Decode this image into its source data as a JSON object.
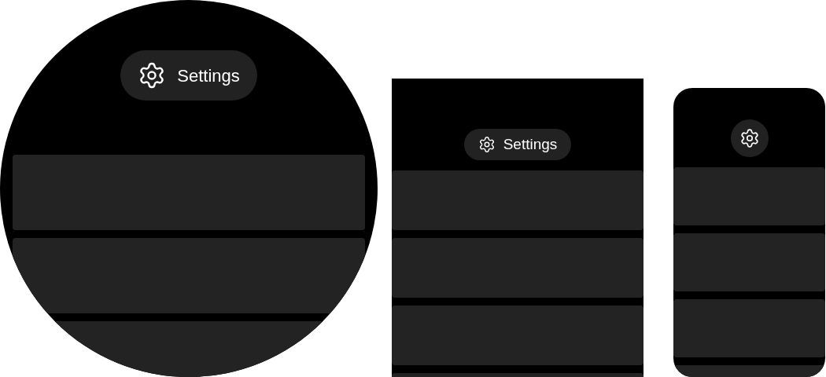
{
  "screens": [
    {
      "kind": "round",
      "header": {
        "label": "Settings"
      }
    },
    {
      "kind": "rect",
      "header": {
        "label": "Settings"
      }
    },
    {
      "kind": "small"
    }
  ]
}
